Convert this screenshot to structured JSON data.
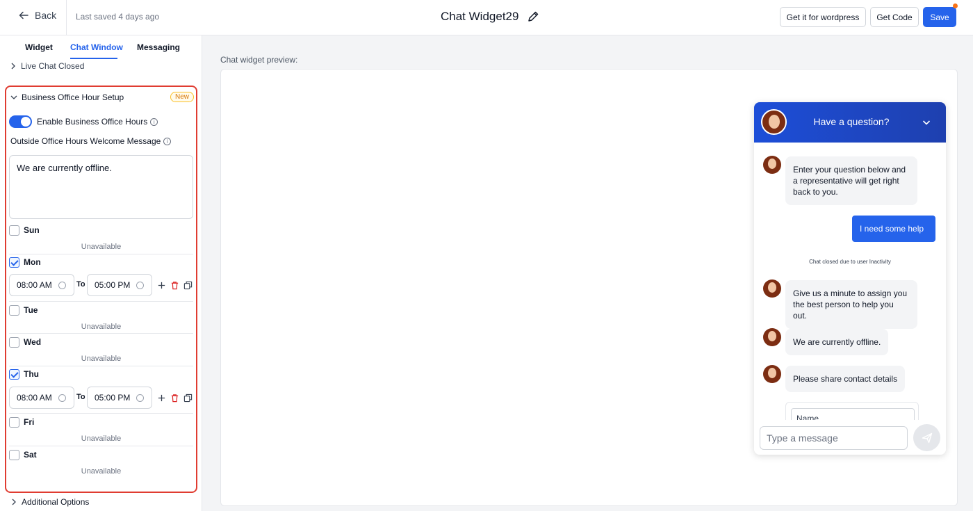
{
  "topbar": {
    "back_label": "Back",
    "last_saved": "Last saved 4 days ago",
    "title": "Chat Widget29",
    "wordpress_label": "Get it for wordpress",
    "get_code_label": "Get Code",
    "save_label": "Save"
  },
  "tabs": [
    {
      "label": "Widget",
      "active": false
    },
    {
      "label": "Chat Window",
      "active": true
    },
    {
      "label": "Messaging",
      "active": false
    }
  ],
  "sections": {
    "live_chat_closed": "Live Chat Closed",
    "business_hours": {
      "title": "Business Office Hour Setup",
      "badge": "New",
      "enable_label": "Enable Business Office Hours",
      "enabled": true,
      "outside_msg_label": "Outside Office Hours Welcome Message",
      "outside_msg_value": "We are currently offline."
    },
    "additional_options": "Additional Options"
  },
  "days": [
    {
      "name": "Sun",
      "checked": false,
      "status": "Unavailable"
    },
    {
      "name": "Mon",
      "checked": true,
      "from": "08:00 AM",
      "to_label": "To",
      "to": "05:00 PM"
    },
    {
      "name": "Tue",
      "checked": false,
      "status": "Unavailable"
    },
    {
      "name": "Wed",
      "checked": false,
      "status": "Unavailable"
    },
    {
      "name": "Thu",
      "checked": true,
      "from": "08:00 AM",
      "to_label": "To",
      "to": "05:00 PM"
    },
    {
      "name": "Fri",
      "checked": false,
      "status": "Unavailable"
    },
    {
      "name": "Sat",
      "checked": false,
      "status": "Unavailable"
    }
  ],
  "preview": {
    "label": "Chat widget preview:",
    "widget": {
      "header_title": "Have a question?",
      "messages": [
        {
          "from": "agent",
          "text": "Enter your question below and a representative will get right back to you."
        },
        {
          "from": "user",
          "text": "I need some help"
        },
        {
          "from": "system",
          "text": "Chat closed due to user Inactivity"
        },
        {
          "from": "agent",
          "text": "Give us a minute to assign you the best person to help you out."
        },
        {
          "from": "agent",
          "text": "We are currently offline."
        },
        {
          "from": "agent",
          "text": "Please share contact details"
        }
      ],
      "name_placeholder": "Name",
      "input_placeholder": "Type a message"
    }
  },
  "colors": {
    "primary": "#2563eb",
    "highlight_border": "#e03c31",
    "delete_icon": "#dc2626",
    "badge": "#d97706"
  }
}
